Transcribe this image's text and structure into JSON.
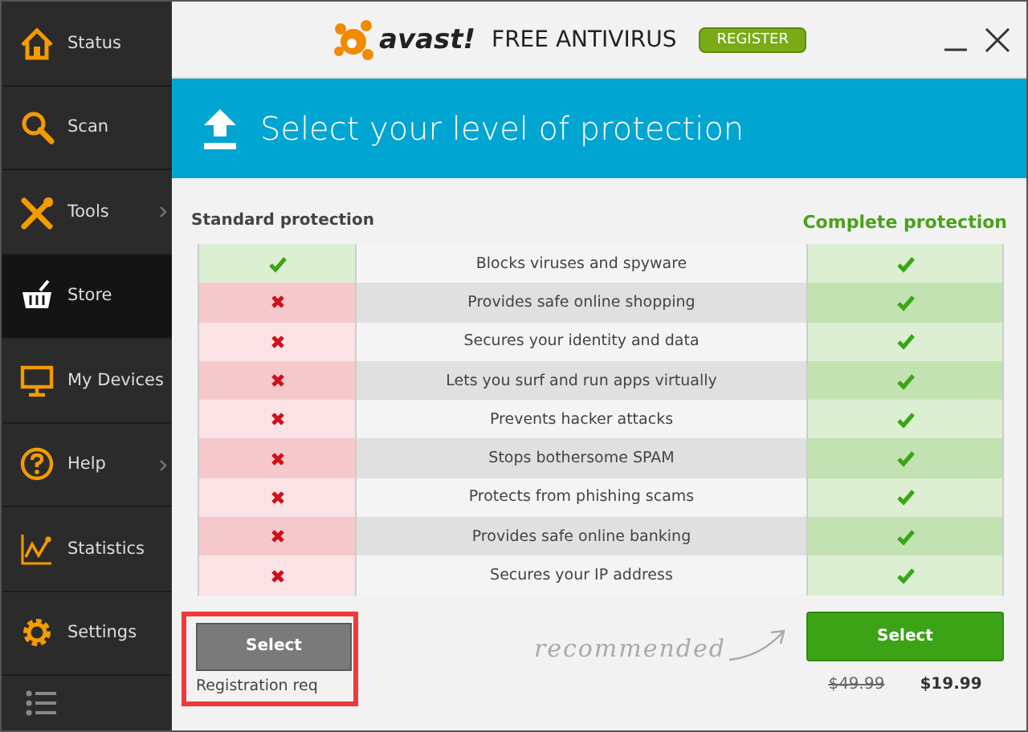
{
  "sidebar": {
    "items": [
      {
        "label": "Status",
        "selected": false,
        "has_submenu": false
      },
      {
        "label": "Scan",
        "selected": false,
        "has_submenu": false
      },
      {
        "label": "Tools",
        "selected": false,
        "has_submenu": true
      },
      {
        "label": "Store",
        "selected": true,
        "has_submenu": false
      },
      {
        "label": "My Devices",
        "selected": false,
        "has_submenu": false
      },
      {
        "label": "Help",
        "selected": false,
        "has_submenu": true
      },
      {
        "label": "Statistics",
        "selected": false,
        "has_submenu": false
      },
      {
        "label": "Settings",
        "selected": false,
        "has_submenu": false
      }
    ]
  },
  "header": {
    "brand": "avast!",
    "product": "FREE ANTIVIRUS",
    "register_button": "REGISTER"
  },
  "banner": {
    "title": "Select your level of protection"
  },
  "plans": {
    "standard_title": "Standard protection",
    "complete_title": "Complete protection"
  },
  "features": [
    {
      "label": "Blocks viruses and spyware",
      "standard": true,
      "complete": true
    },
    {
      "label": "Provides safe online shopping",
      "standard": false,
      "complete": true
    },
    {
      "label": "Secures your identity and data",
      "standard": false,
      "complete": true
    },
    {
      "label": "Lets you surf and run apps virtually",
      "standard": false,
      "complete": true
    },
    {
      "label": "Prevents hacker attacks",
      "standard": false,
      "complete": true
    },
    {
      "label": "Stops bothersome SPAM",
      "standard": false,
      "complete": true
    },
    {
      "label": "Protects from phishing scams",
      "standard": false,
      "complete": true
    },
    {
      "label": "Provides safe online banking",
      "standard": false,
      "complete": true
    },
    {
      "label": "Secures your IP address",
      "standard": false,
      "complete": true
    }
  ],
  "standard_action": {
    "button": "Select",
    "note": "Registration req",
    "highlighted": true
  },
  "recommended": "recommended",
  "complete_action": {
    "button": "Select",
    "old_price": "$49.99",
    "price": "$19.99"
  }
}
